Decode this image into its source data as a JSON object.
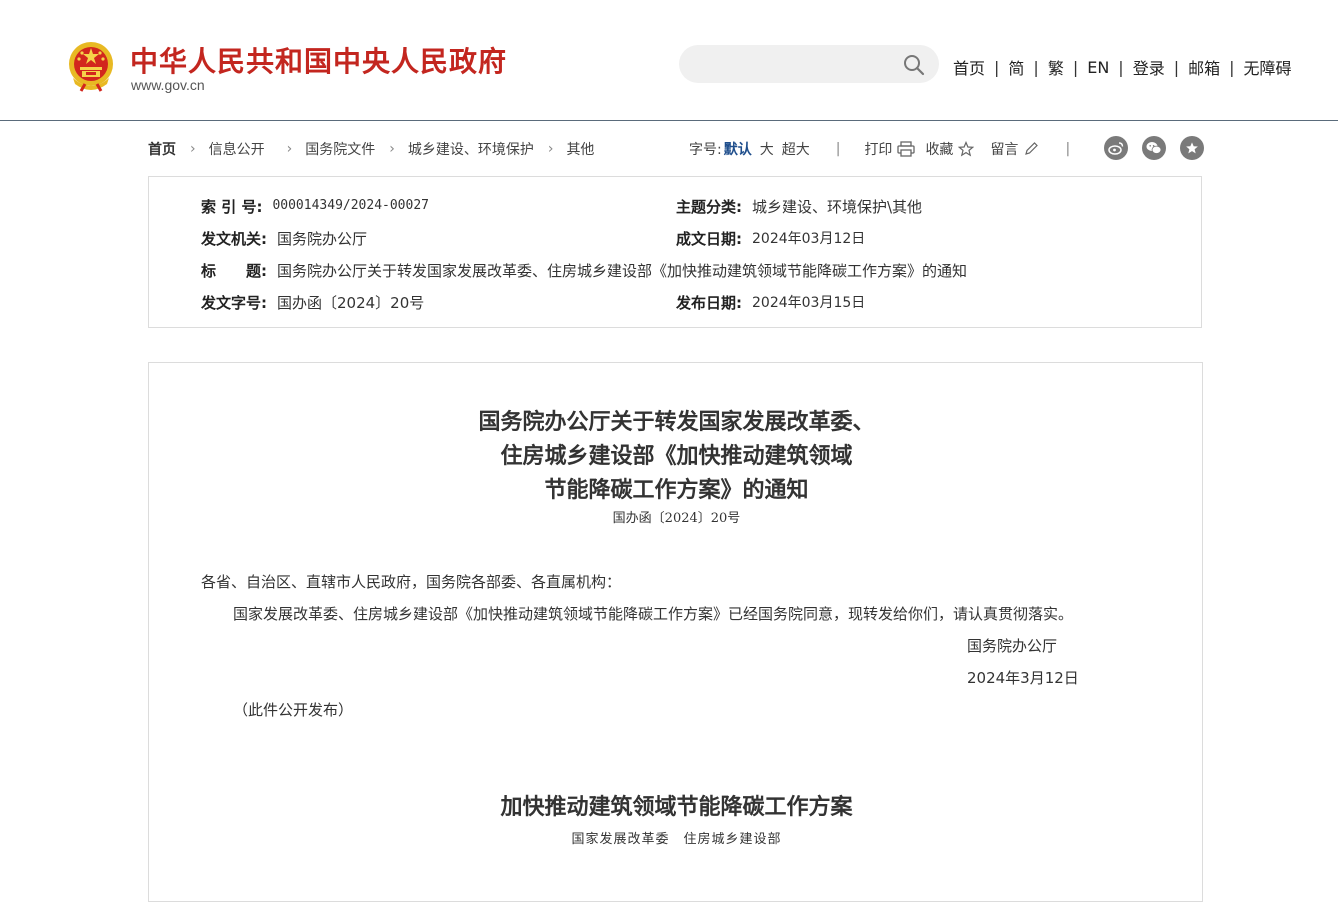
{
  "site": {
    "title": "中华人民共和国中央人民政府",
    "domain": "www.gov.cn"
  },
  "search": {
    "placeholder": ""
  },
  "top_nav": [
    "首页",
    "简",
    "繁",
    "EN",
    "登录",
    "邮箱",
    "无障碍"
  ],
  "breadcrumb": [
    "首页",
    "信息公开",
    "国务院文件",
    "城乡建设、环境保护",
    "其他"
  ],
  "tools": {
    "font_size_label": "字号:",
    "font_default": "默认",
    "font_large": "大",
    "font_xlarge": "超大",
    "print": "打印",
    "favorite": "收藏",
    "comment": "留言"
  },
  "share_icons": [
    "weibo-icon",
    "wechat-icon",
    "star-icon"
  ],
  "meta": {
    "index_label": "索 引 号:",
    "index_value": "000014349/2024-00027",
    "category_label": "主题分类:",
    "category_value": "城乡建设、环境保护\\其他",
    "issuer_label": "发文机关:",
    "issuer_value": "国务院办公厅",
    "date_written_label": "成文日期:",
    "date_written_value": "2024年03月12日",
    "title_label": "标　　题:",
    "title_value": "国务院办公厅关于转发国家发展改革委、住房城乡建设部《加快推动建筑领域节能降碳工作方案》的通知",
    "doc_no_label": "发文字号:",
    "doc_no_value": "国办函〔2024〕20号",
    "date_published_label": "发布日期:",
    "date_published_value": "2024年03月15日"
  },
  "document": {
    "title_lines": [
      "国务院办公厅关于转发国家发展改革委、",
      "住房城乡建设部《加快推动建筑领域",
      "节能降碳工作方案》的通知"
    ],
    "number": "国办函〔2024〕20号",
    "salutation": "各省、自治区、直辖市人民政府，国务院各部委、各直属机构：",
    "body": "国家发展改革委、住房城乡建设部《加快推动建筑领域节能降碳工作方案》已经国务院同意，现转发给你们，请认真贯彻落实。",
    "signature": "国务院办公厅",
    "sign_date": "2024年3月12日",
    "note": "（此件公开发布）",
    "plan_title": "加快推动建筑领域节能降碳工作方案",
    "plan_orgs": "国家发展改革委　住房城乡建设部"
  },
  "colors": {
    "brand_red": "#c3261f",
    "link_blue": "#1f4e8c"
  }
}
